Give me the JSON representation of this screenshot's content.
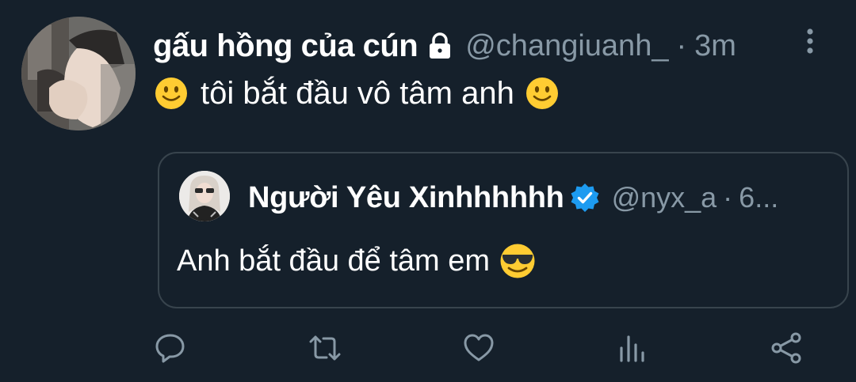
{
  "tweet": {
    "author": {
      "display_name": "gấu hồng của cún",
      "handle": "@changiuanh_",
      "protected_icon": "lock-icon"
    },
    "separator": "·",
    "time": "3m",
    "text": "tôi bắt đầu vô tâm anh",
    "emoji_left": "slightly-smiling-face",
    "emoji_right": "slightly-smiling-face"
  },
  "quoted_tweet": {
    "author": {
      "display_name": "Người Yêu Xinhhhhhh",
      "handle": "@nyx_a",
      "verified_icon": "verified-badge-icon"
    },
    "separator": "·",
    "time": "6...",
    "text": "Anh bắt đầu để tâm em",
    "emoji": "smiling-face-with-sunglasses"
  },
  "actions": [
    "reply-icon",
    "retweet-icon",
    "like-icon",
    "analytics-icon",
    "share-icon"
  ],
  "colors": {
    "background": "#15202b",
    "text_primary": "#ffffff",
    "text_secondary": "#8899a6",
    "border": "#38444d",
    "verified": "#1d9bf0"
  }
}
